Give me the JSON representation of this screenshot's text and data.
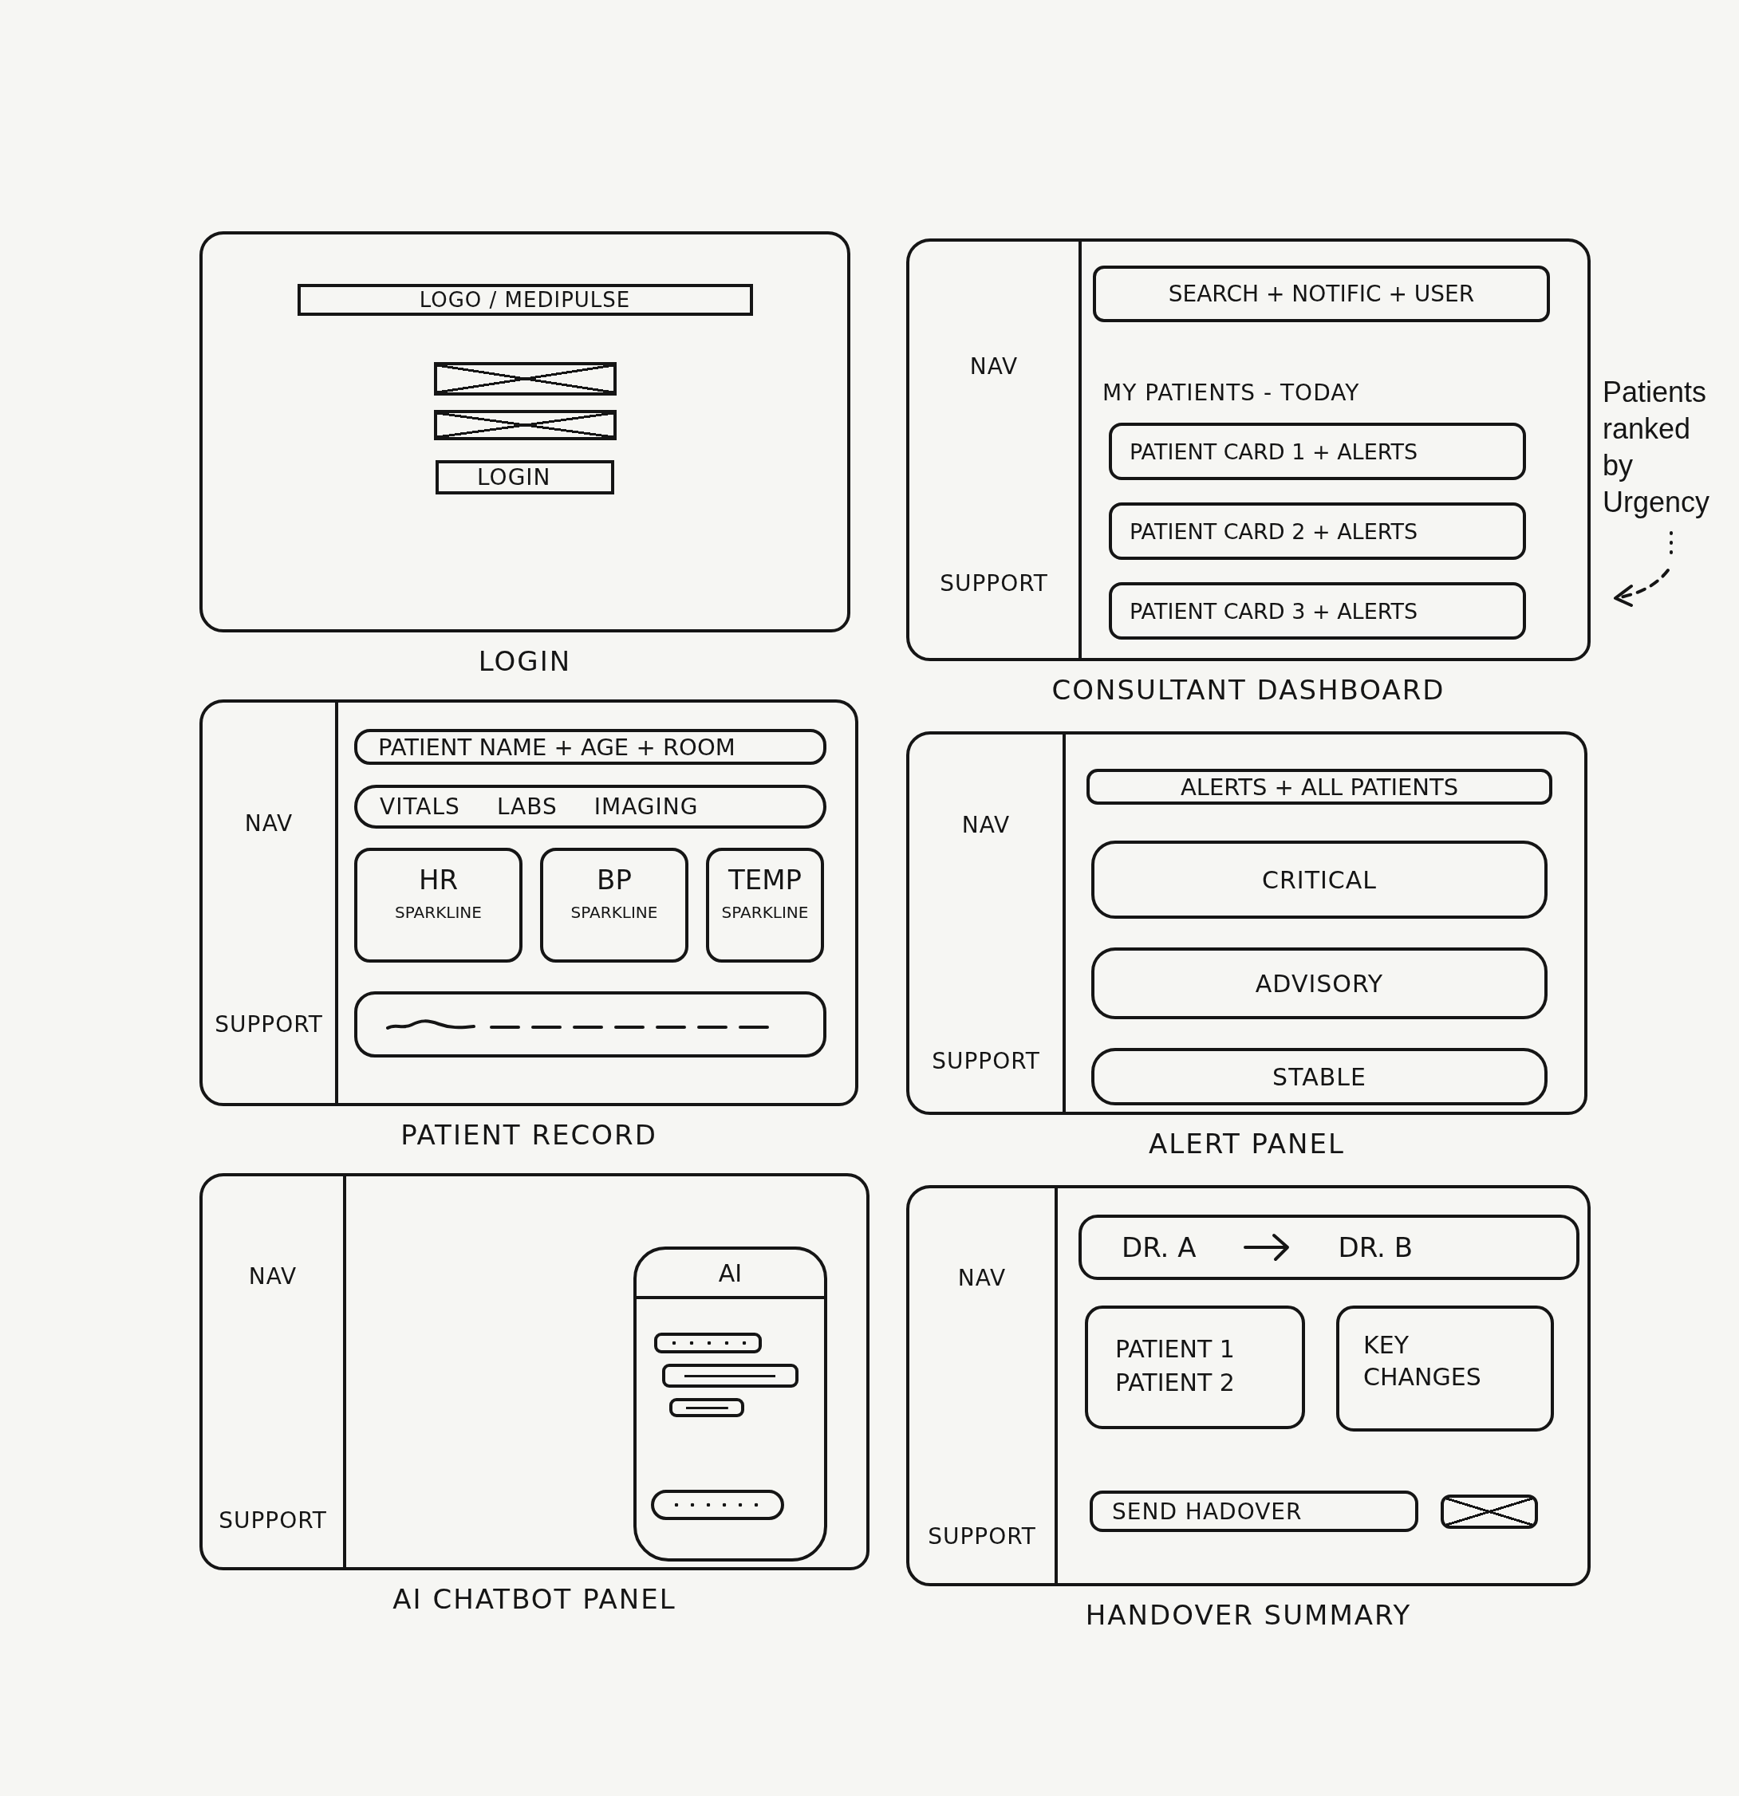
{
  "screens": [
    {
      "kind": "login",
      "caption": "LOGIN",
      "logo_bar": "LOGO / MEDIPULSE",
      "button": "LOGIN"
    },
    {
      "kind": "dashboard",
      "caption": "CONSULTANT DASHBOARD",
      "sidebar": {
        "nav": "NAV",
        "support": "SUPPORT"
      },
      "top_bar": "SEARCH + NOTIFIC + USER",
      "heading": "MY PATIENTS - TODAY",
      "cards": [
        "PATIENT CARD 1 + ALERTS",
        "PATIENT CARD 2 + ALERTS",
        "PATIENT CARD 3 + ALERTS"
      ],
      "note": "Patients ranked by Urgency"
    },
    {
      "kind": "record",
      "caption": "PATIENT RECORD",
      "sidebar": {
        "nav": "NAV",
        "support": "SUPPORT"
      },
      "header": "PATIENT NAME + AGE + ROOM",
      "tabs": [
        "VITALS",
        "LABS",
        "IMAGING"
      ],
      "vitals": [
        {
          "label": "HR",
          "sub": "SPARKLINE"
        },
        {
          "label": "BP",
          "sub": "SPARKLINE"
        },
        {
          "label": "TEMP",
          "sub": "SPARKLINE"
        }
      ]
    },
    {
      "kind": "alerts",
      "caption": "ALERT PANEL",
      "sidebar": {
        "nav": "NAV",
        "support": "SUPPORT"
      },
      "header": "ALERTS + ALL PATIENTS",
      "groups": [
        "CRITICAL",
        "ADVISORY",
        "STABLE"
      ]
    },
    {
      "kind": "chatbot",
      "caption": "AI CHATBOT PANEL",
      "sidebar": {
        "nav": "NAV",
        "support": "SUPPORT"
      },
      "chat_title": "AI"
    },
    {
      "kind": "handover",
      "caption": "HANDOVER SUMMARY",
      "sidebar": {
        "nav": "NAV",
        "support": "SUPPORT"
      },
      "from": "DR. A",
      "to": "DR. B",
      "patients": [
        "PATIENT 1",
        "PATIENT 2"
      ],
      "changes": "KEY CHANGES",
      "button": "SEND HADOVER"
    }
  ]
}
